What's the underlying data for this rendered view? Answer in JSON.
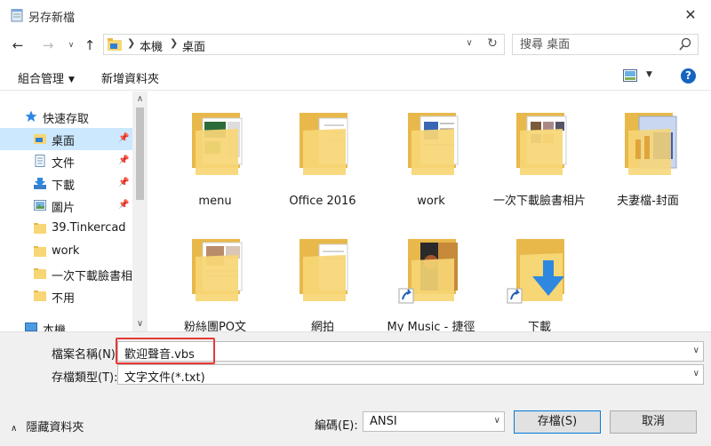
{
  "window": {
    "title": "另存新檔"
  },
  "nav": {
    "breadcrumb": [
      "本機",
      "桌面"
    ],
    "search_placeholder": "搜尋 桌面"
  },
  "toolbar": {
    "organize_label": "組合管理",
    "new_folder_label": "新增資料夾"
  },
  "sidebar": {
    "items": [
      {
        "label": "快速存取",
        "icon": "star-icon"
      },
      {
        "label": "桌面",
        "icon": "desktop-folder-icon",
        "pinned": true,
        "selected": true
      },
      {
        "label": "文件",
        "icon": "documents-icon",
        "pinned": true
      },
      {
        "label": "下載",
        "icon": "downloads-icon",
        "pinned": true
      },
      {
        "label": "圖片",
        "icon": "pictures-icon",
        "pinned": true
      },
      {
        "label": "39.Tinkercad",
        "icon": "folder-icon"
      },
      {
        "label": "work",
        "icon": "folder-icon"
      },
      {
        "label": "一次下載臉書相片",
        "icon": "folder-icon"
      },
      {
        "label": "不用",
        "icon": "folder-icon"
      },
      {
        "label": "本機",
        "icon": "computer-icon"
      }
    ]
  },
  "files": [
    {
      "label": "menu",
      "type": "folder"
    },
    {
      "label": "Office 2016",
      "type": "folder"
    },
    {
      "label": "work",
      "type": "folder"
    },
    {
      "label": "一次下載臉書相片",
      "type": "folder"
    },
    {
      "label": "夫妻檔-封面",
      "type": "folder"
    },
    {
      "label": "粉絲團PO文",
      "type": "folder"
    },
    {
      "label": "網拍",
      "type": "folder"
    },
    {
      "label": "My Music - 捷徑",
      "type": "shortcut"
    },
    {
      "label": "下載",
      "type": "shortcut"
    }
  ],
  "form": {
    "filename_label": "檔案名稱(N):",
    "filename_value": "歡迎聲音.vbs",
    "filetype_label": "存檔類型(T):",
    "filetype_value": "文字文件(*.txt)",
    "encoding_label": "編碼(E):",
    "encoding_value": "ANSI"
  },
  "footer": {
    "hide_folders_label": "隱藏資料夾",
    "save_label": "存檔(S)",
    "cancel_label": "取消"
  },
  "colors": {
    "folder": "#f7d675",
    "folder_dark": "#e8b84a",
    "selection": "#cce8ff",
    "accent": "#0078d7",
    "highlight_box": "#e53935"
  }
}
